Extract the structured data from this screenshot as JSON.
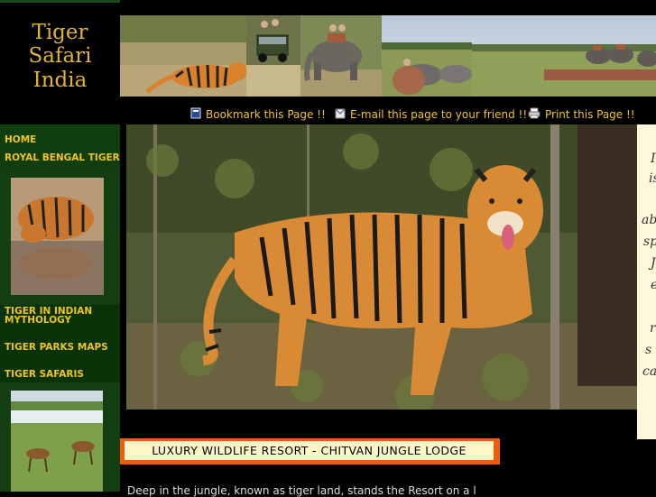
{
  "logo": {
    "line1": "Tiger",
    "line2": "Safari",
    "line3": "India"
  },
  "toolbar": {
    "bookmark": "Bookmark this Page !!",
    "email": "E-mail this page to your friend !!",
    "print": "Print this Page !!"
  },
  "nav": {
    "home": "HOME",
    "royal": "ROYAL BENGAL TIGER",
    "mythology_line1": "TIGER IN INDIAN",
    "mythology_line2": "MYTHOLOGY",
    "maps": "TIGER PARKS MAPS",
    "safaris": "TIGER SAFARIS"
  },
  "side_text": [
    "I",
    "is",
    "",
    "ab",
    "sp",
    "J",
    "e",
    "",
    "r",
    "s",
    "ca"
  ],
  "resort_title": "LUXURY WILDLIFE RESORT - CHITVAN JUNGLE LODGE",
  "body_snippet": "Deep in the jungle, known as tiger land, stands the Resort on a l",
  "colors": {
    "accent": "#f0c420",
    "nav_bg": "#0f3e0f",
    "resort_border": "#f25c05",
    "resort_bg": "#fdf6c8"
  }
}
